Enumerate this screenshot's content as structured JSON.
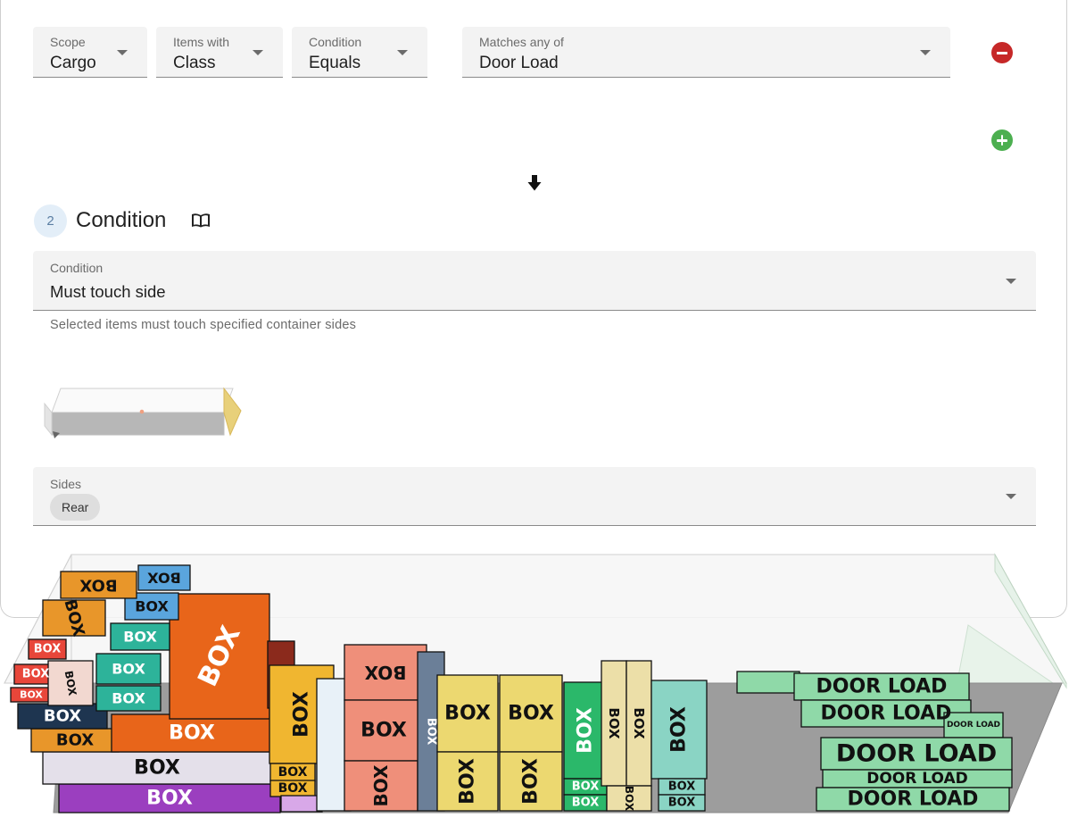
{
  "filter": {
    "scope": {
      "label": "Scope",
      "value": "Cargo"
    },
    "items_with": {
      "label": "Items with",
      "value": "Class"
    },
    "condition": {
      "label": "Condition",
      "value": "Equals"
    },
    "matches": {
      "label": "Matches any of",
      "value": "Door Load"
    }
  },
  "icons": {
    "remove": "remove-circle-icon",
    "add": "add-circle-icon",
    "arrow": "arrow-down-icon",
    "docs": "book-icon"
  },
  "step": {
    "number": "2",
    "title": "Condition"
  },
  "condition_select": {
    "label": "Condition",
    "value": "Must touch side",
    "helper": "Selected items must touch specified container sides"
  },
  "sides_select": {
    "label": "Sides",
    "chips": [
      "Rear"
    ]
  },
  "load_view": {
    "generic_label": "BOX",
    "door_label": "DOOR LOAD",
    "colors": {
      "remove": "#c62828",
      "add": "#4caf50",
      "door_load": "#8fd9a8",
      "floor": "#a9a9a9",
      "rear_highlight": "#e8d07a"
    }
  }
}
